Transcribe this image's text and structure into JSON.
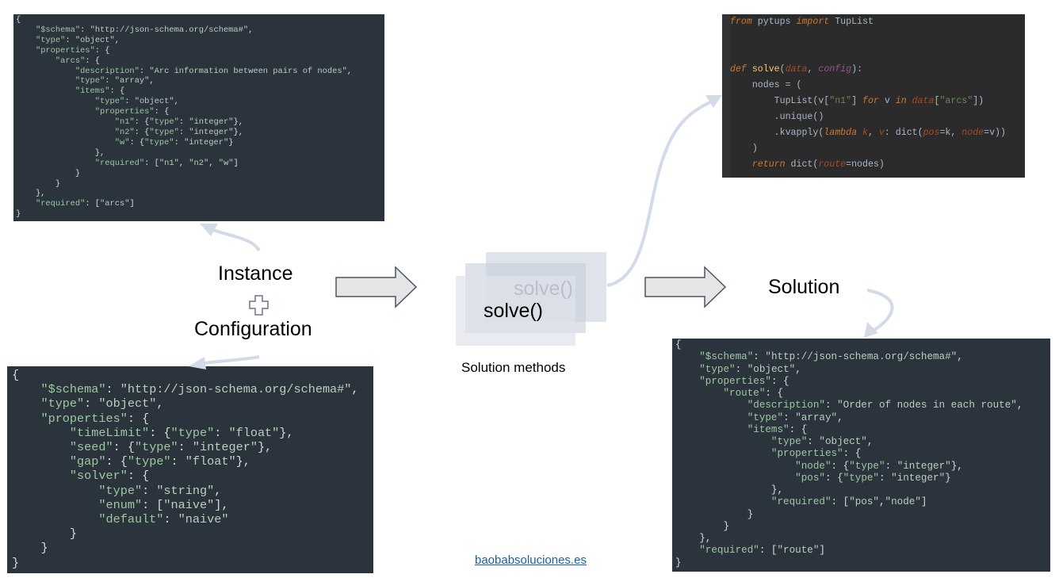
{
  "labels": {
    "instance": "Instance",
    "configuration": "Configuration",
    "solution": "Solution",
    "solution_methods": "Solution methods",
    "solve_back": "solve()",
    "solve_front": "solve()",
    "plus_icon": "plus-icon",
    "website": "baobabsoluciones.es"
  },
  "colors": {
    "panel_bg": "#2b333c",
    "ide_bg": "#2b2b2b",
    "arrow_fill": "#e5e5e5",
    "arrow_stroke": "#4a5566",
    "curve_stroke": "#d3dae8"
  },
  "instance_schema": [
    "{",
    "    \"$schema\": \"http://json-schema.org/schema#\",",
    "    \"type\": \"object\",",
    "    \"properties\": {",
    "        \"arcs\": {",
    "            \"description\": \"Arc information between pairs of nodes\",",
    "            \"type\": \"array\",",
    "            \"items\": {",
    "                \"type\": \"object\",",
    "                \"properties\": {",
    "                    \"n1\": {\"type\": \"integer\"},",
    "                    \"n2\": {\"type\": \"integer\"},",
    "                    \"w\": {\"type\": \"integer\"}",
    "                },",
    "                \"required\": [\"n1\", \"n2\", \"w\"]",
    "            }",
    "        }",
    "    },",
    "    \"required\": [\"arcs\"]",
    "}"
  ],
  "config_schema": [
    "{",
    "    \"$schema\": \"http://json-schema.org/schema#\",",
    "    \"type\": \"object\",",
    "    \"properties\": {",
    "        \"timeLimit\": {\"type\": \"float\"},",
    "        \"seed\": {\"type\": \"integer\"},",
    "        \"gap\": {\"type\": \"float\"},",
    "        \"solver\": {",
    "            \"type\": \"string\",",
    "            \"enum\": [\"naive\"],",
    "            \"default\": \"naive\"",
    "        }",
    "    }",
    "}"
  ],
  "solution_schema": [
    "{",
    "    \"$schema\": \"http://json-schema.org/schema#\",",
    "    \"type\": \"object\",",
    "    \"properties\": {",
    "        \"route\": {",
    "            \"description\": \"Order of nodes in each route\",",
    "            \"type\": \"array\",",
    "            \"items\": {",
    "                \"type\": \"object\",",
    "                \"properties\": {",
    "                    \"node\": {\"type\": \"integer\"},",
    "                    \"pos\": {\"type\": \"integer\"}",
    "                },",
    "                \"required\": [\"pos\",\"node\"]",
    "            }",
    "        }",
    "    },",
    "    \"required\": [\"route\"]",
    "}"
  ],
  "python_code": {
    "line1": {
      "from": "from",
      "module": " pytups ",
      "import": "import",
      "name": " TupList"
    },
    "line2": {
      "def": "def",
      "name": " solve",
      "open": "(",
      "p1": "data",
      "comma": ", ",
      "p2": "config",
      "close": "):"
    },
    "line3": {
      "text": "    nodes = ("
    },
    "line4": {
      "a": "        TupList(v[",
      "s1": "\"n1\"",
      "b": "] ",
      "for": "for",
      "c": " v ",
      "in": "in",
      "d": " ",
      "data": "data",
      "e": "[",
      "s2": "\"arcs\"",
      "f": "])"
    },
    "line5": {
      "text": "        .unique()"
    },
    "line6": {
      "a": "        .kvapply(",
      "lambda": "lambda",
      "b": " ",
      "k": "k",
      "c": ", ",
      "v": "v",
      "d": ": dict(",
      "pos": "pos",
      "e": "=k, ",
      "node": "node",
      "f": "=v))"
    },
    "line7": {
      "text": "    )"
    },
    "line8": {
      "ret": "    return",
      "a": " dict(",
      "route": "route",
      "b": "=nodes)"
    }
  }
}
